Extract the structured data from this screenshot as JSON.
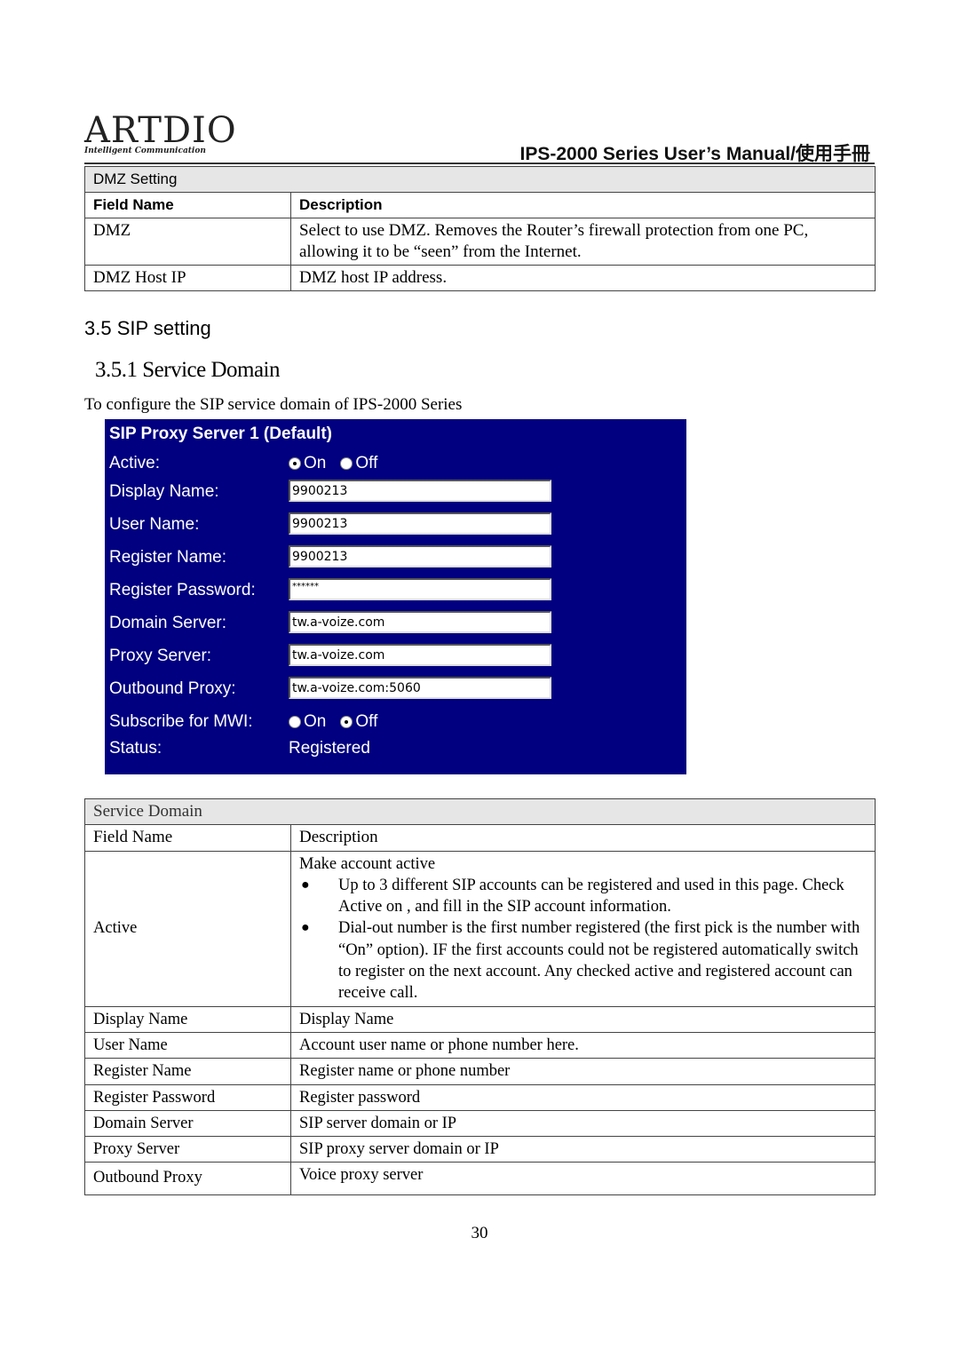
{
  "header": {
    "logo_main": "ARTDIO",
    "logo_tagline": "Intelligent Communication",
    "manual_title": "IPS-2000 Series User’s Manual/使用手冊"
  },
  "dmz_table": {
    "caption": "DMZ Setting",
    "columns": [
      "Field Name",
      "Description"
    ],
    "rows": [
      {
        "field": "DMZ",
        "description": "Select to use DMZ. Removes the Router’s firewall protection from one PC, allowing it to be “seen” from the Internet."
      },
      {
        "field": "DMZ Host IP",
        "description": "DMZ host IP address."
      }
    ]
  },
  "section": {
    "heading": "3.5 SIP setting",
    "subheading": "3.5.1 Service Domain",
    "intro": "To configure the SIP service domain of IPS-2000 Series"
  },
  "sip_panel": {
    "title": "SIP Proxy Server 1 (Default)",
    "active": {
      "label": "Active:",
      "options": [
        "On",
        "Off"
      ],
      "selected": "On"
    },
    "fields": [
      {
        "label": "Display Name:",
        "value": "9900213"
      },
      {
        "label": "User Name:",
        "value": "9900213"
      },
      {
        "label": "Register Name:",
        "value": "9900213"
      },
      {
        "label": "Register Password:",
        "value": "******"
      },
      {
        "label": "Domain Server:",
        "value": "tw.a-voize.com"
      },
      {
        "label": "Proxy Server:",
        "value": "tw.a-voize.com"
      },
      {
        "label": "Outbound Proxy:",
        "value": "tw.a-voize.com:5060"
      }
    ],
    "mwi": {
      "label": "Subscribe for MWI:",
      "options": [
        "On",
        "Off"
      ],
      "selected": "Off"
    },
    "status": {
      "label": "Status:",
      "value": "Registered"
    },
    "colors": {
      "background": "#000080",
      "text": "#ffffff"
    }
  },
  "service_domain_table": {
    "caption": "Service Domain",
    "columns": [
      "Field Name",
      "Description"
    ],
    "active_row": {
      "field": "Active",
      "intro": "Make account active",
      "bullets": [
        "Up to 3 different SIP accounts can be registered and used in this page. Check Active on , and fill in the SIP account information.",
        "Dial-out number is the first number registered (the first pick is the number with “On” option). IF the first accounts could not be registered automatically switch to register on the next account. Any checked active and registered account can receive call."
      ],
      "bullet_glyph": "●"
    },
    "rows": [
      {
        "field": "Display Name",
        "description": "Display Name"
      },
      {
        "field": "User Name",
        "description": "Account user name or phone number here."
      },
      {
        "field": "Register Name",
        "description": "Register name or phone number"
      },
      {
        "field": "Register Password",
        "description": "Register password"
      },
      {
        "field": "Domain Server",
        "description": "SIP server domain or IP"
      },
      {
        "field": "Proxy Server",
        "description": "SIP proxy server domain or IP"
      },
      {
        "field": "Outbound Proxy",
        "description": "Voice proxy server"
      }
    ]
  },
  "footer": {
    "page_number": "30"
  }
}
